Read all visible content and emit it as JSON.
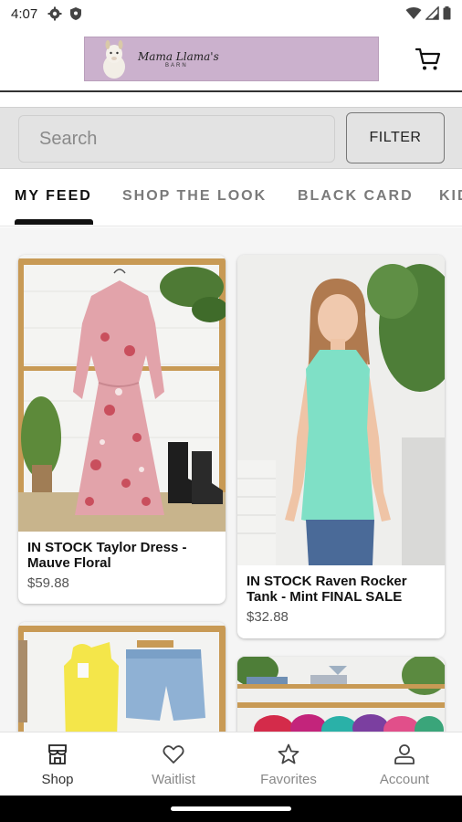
{
  "status_bar": {
    "time": "4:07",
    "icons_left": [
      "gear-icon",
      "shield-icon"
    ],
    "icons_right": [
      "wifi-icon",
      "signal-icon",
      "battery-icon"
    ]
  },
  "header": {
    "logo_name": "Mama Llama's",
    "logo_sub": "BARN",
    "logo_bg": "#cbb1cd",
    "cart_icon": "cart-icon"
  },
  "search": {
    "placeholder": "Search",
    "filter_label": "FILTER"
  },
  "tabs": [
    {
      "label": "MY FEED",
      "active": true
    },
    {
      "label": "SHOP THE LOOK",
      "active": false
    },
    {
      "label": "BLACK CARD",
      "active": false
    },
    {
      "label": "KIDS",
      "active": false
    }
  ],
  "products": [
    {
      "title": "IN STOCK Taylor Dress - Mauve Floral",
      "price": "$59.88"
    },
    {
      "title": "IN STOCK Raven Rocker Tank - Mint FINAL SALE",
      "price": "$32.88"
    },
    {
      "title": "",
      "price": ""
    },
    {
      "title": "",
      "price": ""
    }
  ],
  "bottom_nav": [
    {
      "label": "Shop",
      "icon": "store-icon",
      "active": true
    },
    {
      "label": "Waitlist",
      "icon": "heart-icon",
      "active": false
    },
    {
      "label": "Favorites",
      "icon": "star-icon",
      "active": false
    },
    {
      "label": "Account",
      "icon": "person-icon",
      "active": false
    }
  ]
}
